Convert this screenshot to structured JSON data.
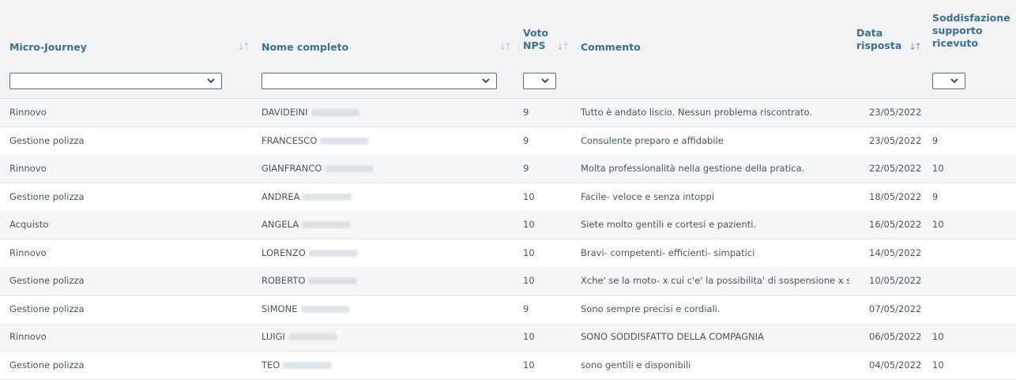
{
  "headers": {
    "micro_journey": "Micro-Journey",
    "nome_completo": "Nome completo",
    "voto_nps_line1": "Voto",
    "voto_nps_line2": "NPS",
    "commento": "Commento",
    "data_line1": "Data",
    "data_line2": "risposta",
    "soddisfazione_line1": "Soddisfazione",
    "soddisfazione_line2": "supporto",
    "soddisfazione_line3": "ricevuto"
  },
  "icons": {
    "sort": "sort-both-icon",
    "sort_active": "sort-desc-icon",
    "dropdown": "chevron-down-icon"
  },
  "colors": {
    "header_text": "#3d6f8f",
    "header_bg": "#f1f3f5",
    "row_alt_bg": "#f5f6f8"
  },
  "rows": [
    {
      "journey": "Rinnovo",
      "name": "DAVIDEINI",
      "nps": "9",
      "comment": "Tutto è andato liscio. Nessun problema riscontrato.",
      "date": "23/05/2022",
      "support": ""
    },
    {
      "journey": "Gestione polizza",
      "name": "FRANCESCO",
      "nps": "9",
      "comment": "Consulente preparo e affidabile",
      "date": "23/05/2022",
      "support": "9"
    },
    {
      "journey": "Rinnovo",
      "name": "GIANFRANCO",
      "nps": "9",
      "comment": "Molta professionalità nella gestione della pratica.",
      "date": "22/05/2022",
      "support": "10"
    },
    {
      "journey": "Gestione polizza",
      "name": "ANDREA",
      "nps": "10",
      "comment": "Facile- veloce e senza intoppi",
      "date": "18/05/2022",
      "support": "9"
    },
    {
      "journey": "Acquisto",
      "name": "ANGELA",
      "nps": "10",
      "comment": "Siete molto gentili e cortesi e pazienti.",
      "date": "16/05/2022",
      "support": "10"
    },
    {
      "journey": "Rinnovo",
      "name": "LORENZO",
      "nps": "10",
      "comment": "Bravi- competenti- efficienti- simpatici",
      "date": "14/05/2022",
      "support": ""
    },
    {
      "journey": "Gestione polizza",
      "name": "ROBERTO",
      "nps": "10",
      "comment": "Xche' se la moto- x cui c'e' la possibilita' di sospensione x st...",
      "date": "10/05/2022",
      "support": ""
    },
    {
      "journey": "Gestione polizza",
      "name": "SIMONE",
      "nps": "9",
      "comment": "Sono sempre precisi e cordiali.",
      "date": "07/05/2022",
      "support": ""
    },
    {
      "journey": "Rinnovo",
      "name": "LUIGI",
      "nps": "10",
      "comment": "SONO SODDISFATTO DELLA COMPAGNIA",
      "date": "06/05/2022",
      "support": "10"
    },
    {
      "journey": "Gestione polizza",
      "name": "TEO",
      "nps": "10",
      "comment": "sono gentili e disponibili",
      "date": "04/05/2022",
      "support": "10"
    }
  ]
}
